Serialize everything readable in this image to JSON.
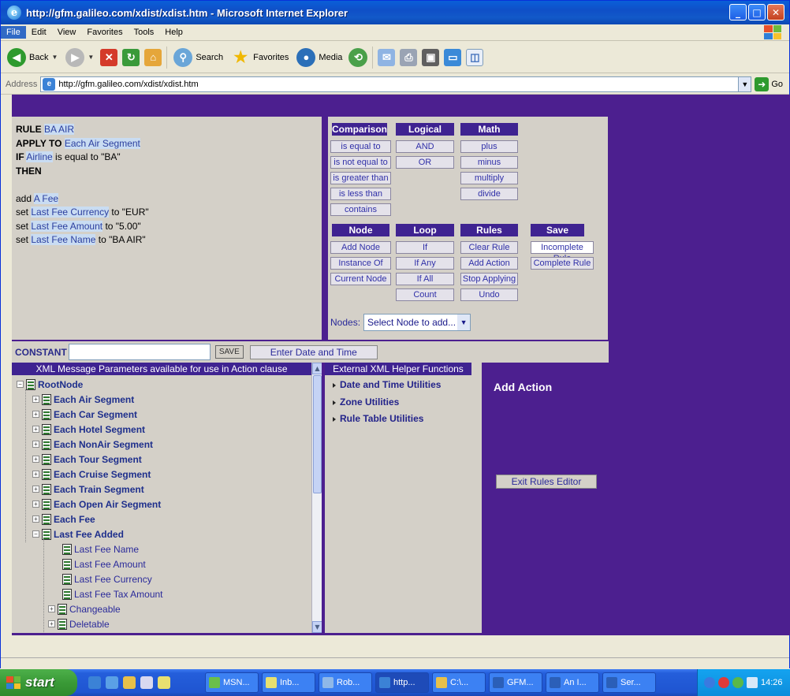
{
  "window": {
    "title": "http://gfm.galileo.com/xdist/xdist.htm - Microsoft Internet Explorer",
    "controls": [
      "minimize",
      "maximize",
      "close"
    ]
  },
  "menu": [
    "File",
    "Edit",
    "View",
    "Favorites",
    "Tools",
    "Help"
  ],
  "toolbar": {
    "back": "Back",
    "search": "Search",
    "favorites": "Favorites",
    "media": "Media"
  },
  "address": {
    "label": "Address",
    "url": "http://gfm.galileo.com/xdist/xdist.htm",
    "go": "Go"
  },
  "rule": {
    "lines": [
      {
        "kw": "RULE",
        "hl": "BA AIR",
        "tail": ""
      },
      {
        "kw": "APPLY TO",
        "hl": "Each Air Segment",
        "tail": ""
      },
      {
        "kw": "IF",
        "hl": "Airline",
        "tail": "is equal to \"BA\""
      },
      {
        "kw": "THEN",
        "hl": "",
        "tail": ""
      },
      {
        "kw": "",
        "hl": "",
        "tail": ""
      },
      {
        "pre": "add",
        "hl": "A Fee",
        "tail": ""
      },
      {
        "pre": "set",
        "hl": "Last Fee Currency",
        "tail": "to \"EUR\""
      },
      {
        "pre": "set",
        "hl": "Last Fee Amount",
        "tail": "to \"5.00\""
      },
      {
        "pre": "set",
        "hl": "Last Fee Name",
        "tail": "to \"BA AIR\""
      }
    ]
  },
  "groups": {
    "comparison": {
      "title": "Comparison",
      "items": [
        "is equal to",
        "is not equal to",
        "is greater than",
        "is less than",
        "contains"
      ]
    },
    "logical": {
      "title": "Logical",
      "items": [
        "AND",
        "OR"
      ]
    },
    "math": {
      "title": "Math",
      "items": [
        "plus",
        "minus",
        "multiply",
        "divide"
      ]
    },
    "node": {
      "title": "Node",
      "items": [
        "Add Node",
        "Instance Of",
        "Current Node"
      ]
    },
    "loop": {
      "title": "Loop",
      "items": [
        "If",
        "If Any",
        "If All",
        "Count"
      ]
    },
    "rules": {
      "title": "Rules",
      "items": [
        "Clear Rule",
        "Add Action",
        "Stop Applying",
        "Undo"
      ]
    },
    "save": {
      "title": "Save",
      "items": [
        "Incomplete Rule",
        "Complete Rule"
      ]
    }
  },
  "nodes": {
    "label": "Nodes:",
    "selected": "Select Node to add..."
  },
  "constant": {
    "label": "CONSTANT",
    "value": "",
    "save": "SAVE",
    "date_button": "Enter Date and Time"
  },
  "tree": {
    "header": "XML Message Parameters available for use in Action clause",
    "root": "RootNode",
    "segments": [
      "Each Air Segment",
      "Each Car Segment",
      "Each Hotel Segment",
      "Each NonAir Segment",
      "Each Tour Segment",
      "Each Cruise Segment",
      "Each Train Segment",
      "Each Open Air Segment",
      "Each Fee",
      "Last Fee Added"
    ],
    "last_fee_children": [
      "Last Fee Name",
      "Last Fee Amount",
      "Last Fee Currency",
      "Last Fee Tax Amount"
    ],
    "more": [
      "Changeable",
      "Deletable"
    ]
  },
  "helpers": {
    "header": "External XML Helper Functions",
    "items": [
      "Date and Time Utilities",
      "Zone Utilities",
      "Rule Table Utilities"
    ]
  },
  "action": {
    "title": "Add Action",
    "exit": "Exit Rules Editor"
  },
  "taskbar": {
    "start": "start",
    "tasks": [
      "MSN...",
      "Inb...",
      "Rob...",
      "http...",
      "C:\\...",
      "GFM...",
      "An I...",
      "Ser..."
    ],
    "clock": "14:26"
  },
  "colors": {
    "accent": "#4c1f8f",
    "header": "#3f2391",
    "panel": "#d4d0c8",
    "link": "#3030a8"
  }
}
